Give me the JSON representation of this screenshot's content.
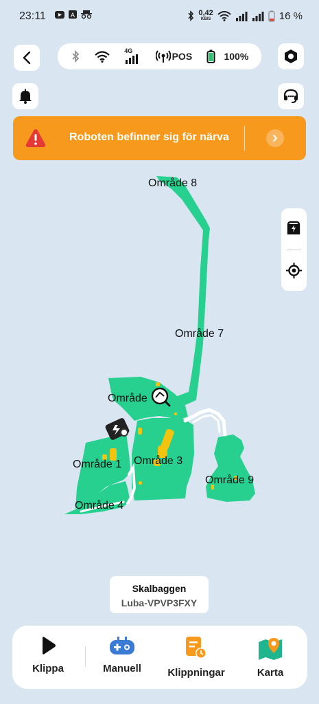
{
  "status_bar": {
    "time": "23:11",
    "net_speed_value": "0,42",
    "net_speed_unit": "KB/S",
    "battery": "16 %"
  },
  "top_bar": {
    "signal_label": "4G",
    "pos_label": "POS",
    "robot_battery": "100%"
  },
  "alert": {
    "message": "Roboten befinner sig för närva"
  },
  "map": {
    "zones": [
      "Område 8",
      "Område 7",
      "Område",
      "Område 1",
      "Område 3",
      "Område 9",
      "Område 4"
    ]
  },
  "robot": {
    "name": "Skalbaggen",
    "id": "Luba-VPVP3FXY"
  },
  "nav": {
    "items": [
      {
        "label": "Klippa"
      },
      {
        "label": "Manuell"
      },
      {
        "label": "Klippningar"
      },
      {
        "label": "Karta"
      }
    ]
  },
  "colors": {
    "zone": "#27d08e",
    "alert": "#f7991c",
    "path": "#ffffff",
    "obstacle": "#f2c40f"
  }
}
